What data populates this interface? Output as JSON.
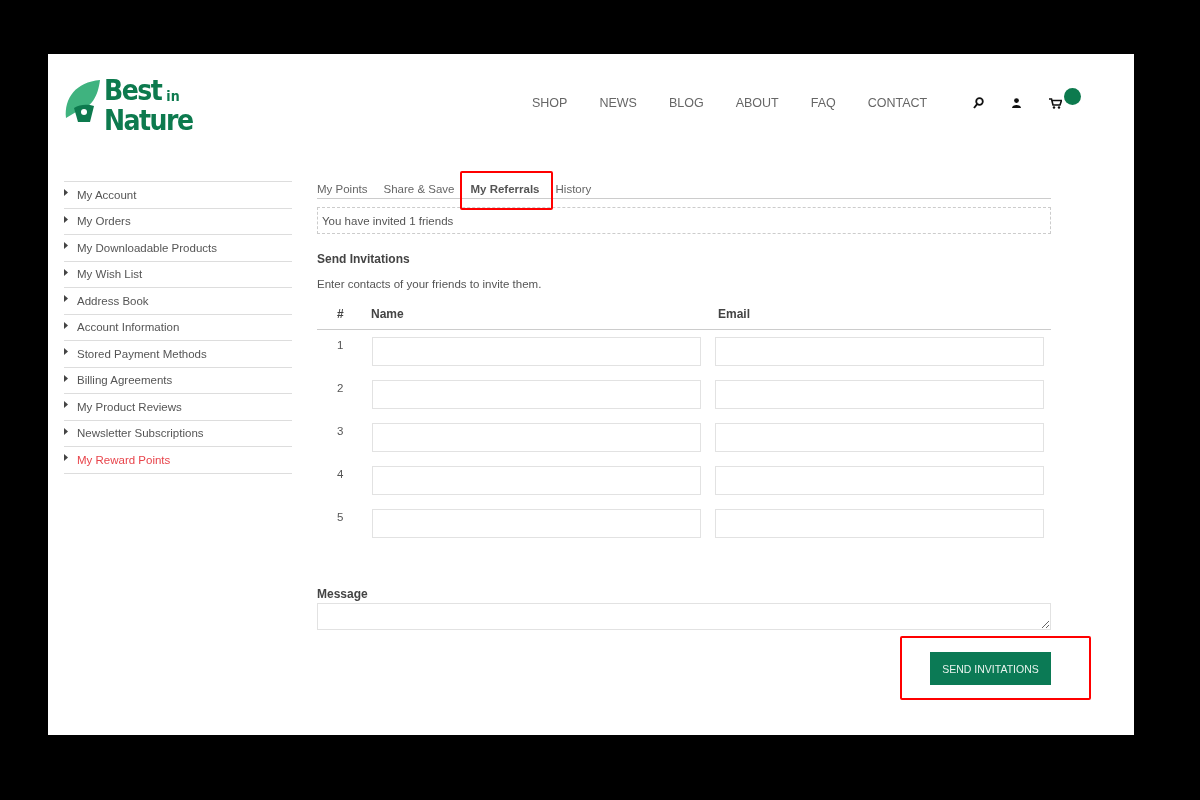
{
  "logo": {
    "line1": "Best",
    "small": "in",
    "line2": "Nature"
  },
  "nav": [
    "SHOP",
    "NEWS",
    "BLOG",
    "ABOUT",
    "FAQ",
    "CONTACT"
  ],
  "cart": {
    "badge": true
  },
  "sidebar": {
    "items": [
      {
        "label": "My Account",
        "selected": false
      },
      {
        "label": "My Orders",
        "selected": false
      },
      {
        "label": "My Downloadable Products",
        "selected": false
      },
      {
        "label": "My Wish List",
        "selected": false
      },
      {
        "label": "Address Book",
        "selected": false
      },
      {
        "label": "Account Information",
        "selected": false
      },
      {
        "label": "Stored Payment Methods",
        "selected": false
      },
      {
        "label": "Billing Agreements",
        "selected": false
      },
      {
        "label": "My Product Reviews",
        "selected": false
      },
      {
        "label": "Newsletter Subscriptions",
        "selected": false
      },
      {
        "label": "My Reward Points",
        "selected": true
      }
    ]
  },
  "tabs": [
    {
      "label": "My Points",
      "selected": false,
      "highlighted": false
    },
    {
      "label": "Share & Save",
      "selected": false,
      "highlighted": false
    },
    {
      "label": "My Referrals",
      "selected": true,
      "highlighted": true
    },
    {
      "label": "History",
      "selected": false,
      "highlighted": false
    }
  ],
  "notice": "You have invited 1 friends",
  "invitations": {
    "title": "Send Invitations",
    "hint": "Enter contacts of your friends to invite them.",
    "columns": [
      "#",
      "Name",
      "Email"
    ],
    "rows": [
      "1",
      "2",
      "3",
      "4",
      "5"
    ]
  },
  "message": {
    "label": "Message"
  },
  "send_button": {
    "label": "SEND INVITATIONS",
    "highlighted": true
  }
}
